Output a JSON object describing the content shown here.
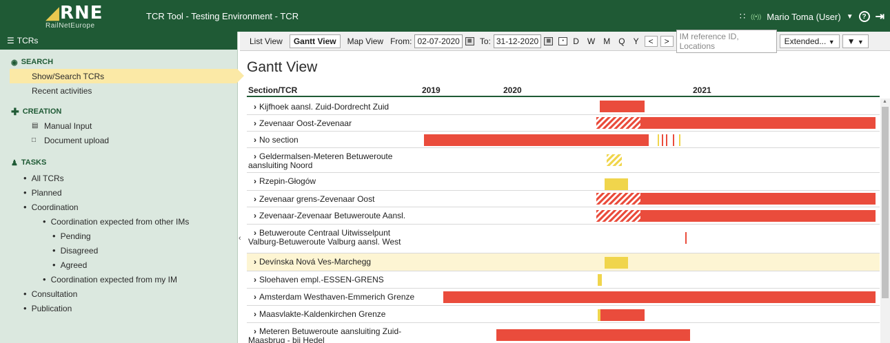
{
  "header": {
    "logo_text": "RNE",
    "logo_sub": "RailNetEurope",
    "title": "TCR Tool - Testing Environment - TCR",
    "user": "Mario Toma (User)",
    "colors": {
      "header_bg": "#1f5a35",
      "accent_yellow": "#e7c84f"
    }
  },
  "sidebar": {
    "header": "TCRs",
    "search": {
      "title": "SEARCH",
      "items": [
        "Show/Search TCRs",
        "Recent activities"
      ]
    },
    "creation": {
      "title": "CREATION",
      "items": [
        "Manual Input",
        "Document upload"
      ]
    },
    "tasks": {
      "title": "TASKS",
      "items": [
        "All TCRs",
        "Planned",
        "Coordination",
        "Coordination expected from other IMs",
        "Pending",
        "Disagreed",
        "Agreed",
        "Coordination expected from my IM",
        "Consultation",
        "Publication"
      ]
    }
  },
  "toolbar": {
    "list_view": "List View",
    "gantt_view": "Gantt View",
    "map_view": "Map View",
    "from_label": "From:",
    "from_date": "02-07-2020",
    "to_label": "To:",
    "to_date": "31-12-2020",
    "periods": [
      "D",
      "W",
      "M",
      "Q",
      "Y"
    ],
    "prev": "<",
    "next": ">",
    "search_placeholder": "IM reference ID, Locations",
    "extended": "Extended..."
  },
  "main": {
    "title": "Gantt View",
    "col_header": "Section/TCR",
    "years": [
      "2019",
      "2020",
      "2021"
    ]
  },
  "gantt_rows": [
    {
      "label": "Kijfhoek aansl. Zuid-Dordrecht Zuid"
    },
    {
      "label": "Zevenaar Oost-Zevenaar"
    },
    {
      "label": "No section"
    },
    {
      "label": "Geldermalsen-Meteren Betuweroute",
      "label2": "aansluiting Noord"
    },
    {
      "label": "Rzepin-Głogów"
    },
    {
      "label": "Zevenaar grens-Zevenaar Oost"
    },
    {
      "label": "Zevenaar-Zevenaar Betuweroute Aansl."
    },
    {
      "label": "Betuweroute Centraal Uitwisselpunt",
      "label2": "Valburg-Betuweroute Valburg aansl. West"
    },
    {
      "label": "Devínska Nová Ves-Marchegg"
    },
    {
      "label": "Sloehaven empl.-ESSEN-GRENS"
    },
    {
      "label": "Amsterdam Westhaven-Emmerich Grenze"
    },
    {
      "label": "Maasvlakte-Kaldenkirchen Grenze"
    },
    {
      "label": "Meteren Betuweroute aansluiting Zuid-",
      "label2": "Maasbrug - bij Hedel"
    }
  ]
}
